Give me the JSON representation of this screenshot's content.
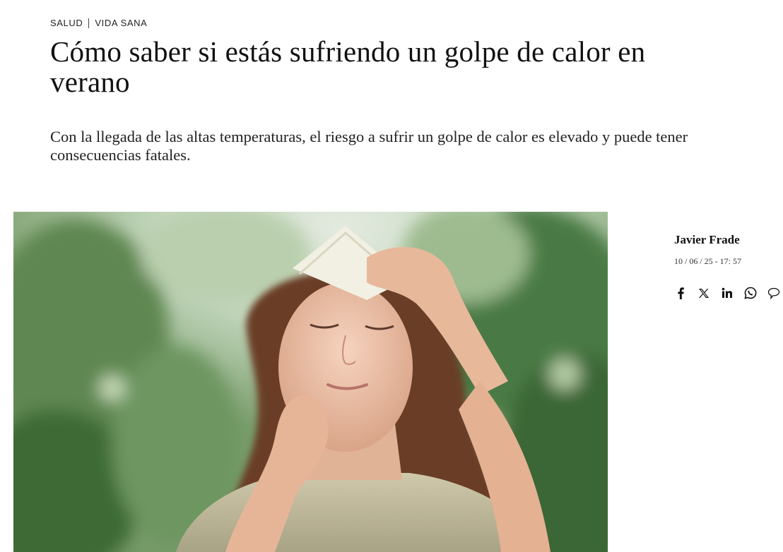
{
  "breadcrumb": {
    "section": "SALUD",
    "subsection": "VIDA SANA"
  },
  "article": {
    "title": "Cómo saber si estás sufriendo un golpe de calor en verano",
    "subtitle": "Con la llegada de las altas temperaturas, el riesgo a sufrir un golpe de calor es elevado y puede tener consecuencias fatales."
  },
  "author": {
    "name": "Javier Frade",
    "date": "10 / 06 / 25 - 17: 57"
  },
  "share": {
    "icons": [
      "facebook-icon",
      "x-icon",
      "linkedin-icon",
      "whatsapp-icon",
      "comment-icon"
    ]
  },
  "colors": {
    "text": "#111111",
    "background": "#ffffff"
  }
}
